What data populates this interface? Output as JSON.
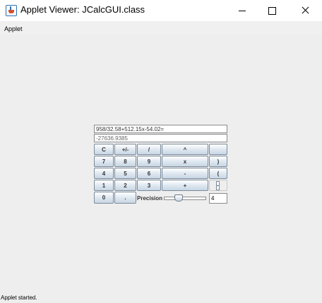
{
  "window": {
    "title": "Applet Viewer: JCalcGUI.class",
    "icon": "java-cup-icon",
    "controls": [
      "minimize-icon",
      "maximize-icon",
      "close-icon"
    ]
  },
  "menubar": {
    "items": [
      "Applet"
    ]
  },
  "calculator": {
    "expression": "958/32.58+512.15x-54.02=",
    "result": "-27636.9385",
    "buttons": {
      "clear": "C",
      "plus_minus": "+/-",
      "divide": "/",
      "power": "^",
      "seven": "7",
      "eight": "8",
      "nine": "9",
      "multiply": "x",
      "close_paren": ")",
      "four": "4",
      "five": "5",
      "six": "6",
      "minus": "-",
      "open_paren": "(",
      "one": "1",
      "two": "2",
      "three": "3",
      "plus": "+",
      "zero": "0",
      "decimal": "."
    },
    "precision_label": "Precision",
    "precision_value": "4"
  },
  "status_bar": {
    "text": "Applet started."
  }
}
